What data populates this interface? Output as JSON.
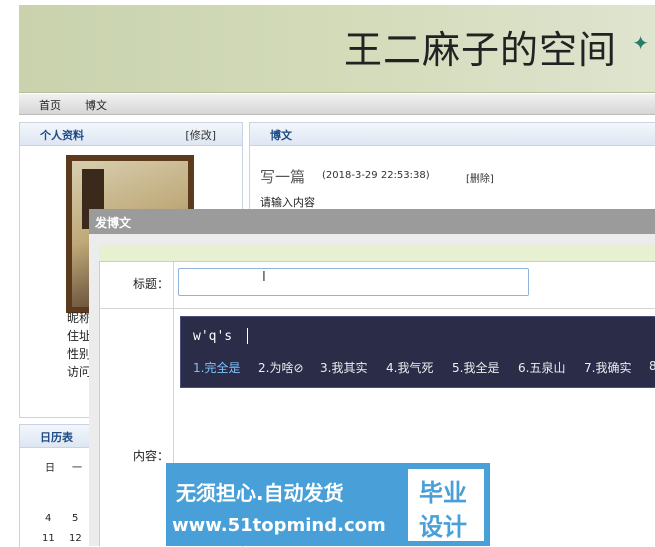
{
  "header": {
    "site_title": "王二麻子的空间"
  },
  "nav": {
    "items": [
      "首页",
      "博文"
    ]
  },
  "profile": {
    "title": "个人资料",
    "edit": "[修改]",
    "labels": [
      "昵称",
      "住址",
      "性别",
      "访问"
    ]
  },
  "calendar": {
    "title": "日历表",
    "weekdays": [
      "日",
      "一"
    ],
    "rows": [
      [
        "4",
        "5"
      ],
      [
        "11",
        "12"
      ]
    ]
  },
  "posts": {
    "title": "博文",
    "entry": {
      "title": "写一篇",
      "time": "(2018-3-29 22:53:38)",
      "delete": "[删除]",
      "body": "请输入内容"
    }
  },
  "modal": {
    "title": "发博文",
    "title_label": "标题：",
    "content_label": "内容：",
    "title_value": ""
  },
  "ime": {
    "composition": "w'q's",
    "candidates": [
      "1.完全是",
      "2.为啥⊘",
      "3.我其实",
      "4.我气死",
      "5.我全是",
      "6.五泉山",
      "7.我确实",
      "8"
    ]
  },
  "watermark": {
    "line1": "无须担心.自动发货",
    "line2": "www.51topmind.com",
    "box_top": "毕业",
    "box_bottom": "设计"
  }
}
